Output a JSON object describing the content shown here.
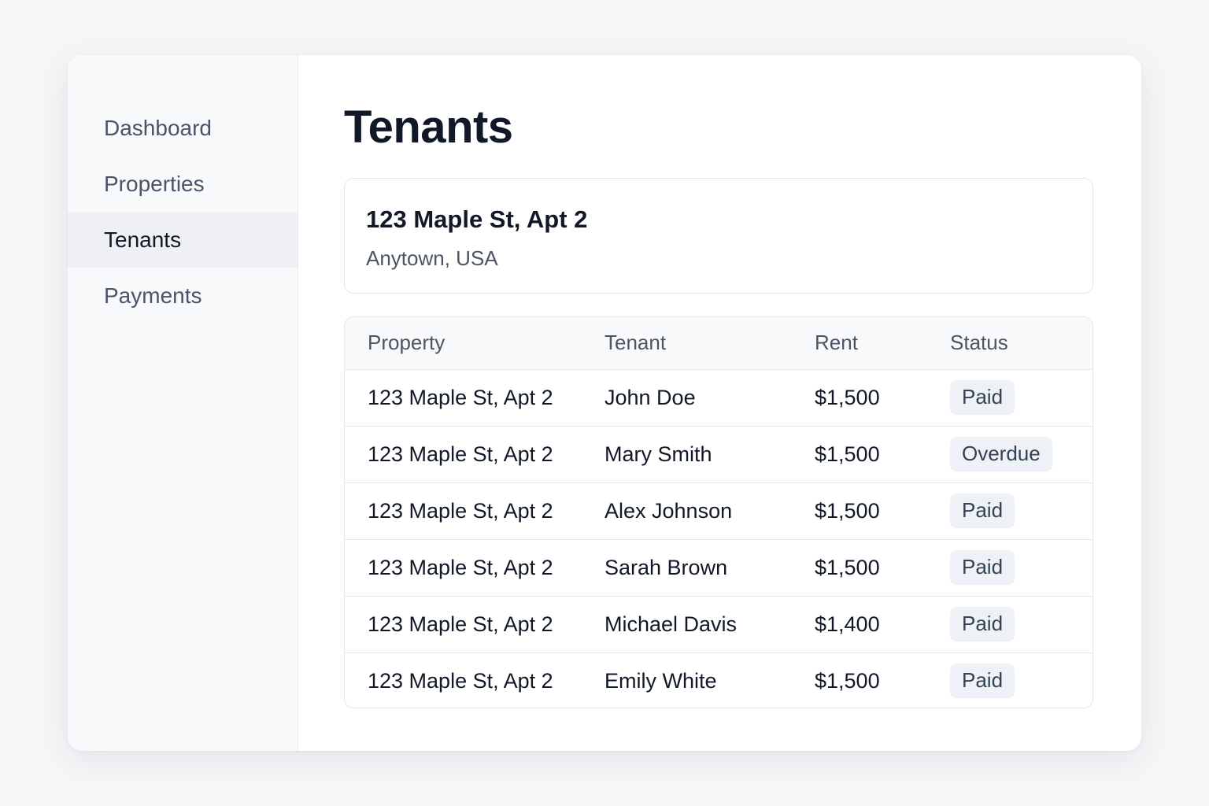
{
  "sidebar": {
    "items": [
      {
        "label": "Dashboard",
        "active": false
      },
      {
        "label": "Properties",
        "active": false
      },
      {
        "label": "Tenants",
        "active": true
      },
      {
        "label": "Payments",
        "active": false
      }
    ]
  },
  "main": {
    "title": "Tenants",
    "property_card": {
      "name": "123 Maple St, Apt 2",
      "location": "Anytown, USA"
    },
    "table": {
      "headers": [
        "Property",
        "Tenant",
        "Rent",
        "Status"
      ],
      "rows": [
        {
          "property": "123 Maple St, Apt 2",
          "tenant": "John Doe",
          "rent": "$1,500",
          "status": "Paid"
        },
        {
          "property": "123 Maple St, Apt 2",
          "tenant": "Mary Smith",
          "rent": "$1,500",
          "status": "Overdue"
        },
        {
          "property": "123 Maple St, Apt 2",
          "tenant": "Alex Johnson",
          "rent": "$1,500",
          "status": "Paid"
        },
        {
          "property": "123 Maple St, Apt 2",
          "tenant": "Sarah Brown",
          "rent": "$1,500",
          "status": "Paid"
        },
        {
          "property": "123 Maple St, Apt 2",
          "tenant": "Michael Davis",
          "rent": "$1,400",
          "status": "Paid"
        },
        {
          "property": "123 Maple St, Apt 2",
          "tenant": "Emily White",
          "rent": "$1,500",
          "status": "Paid"
        }
      ]
    }
  },
  "colors": {
    "background": "#f5f6f8",
    "sidebar_bg": "#f8f9fb",
    "active_nav_bg": "#eef0f4",
    "badge_bg": "#eef2f6",
    "text_primary": "#111827",
    "text_secondary": "#4b5563"
  }
}
